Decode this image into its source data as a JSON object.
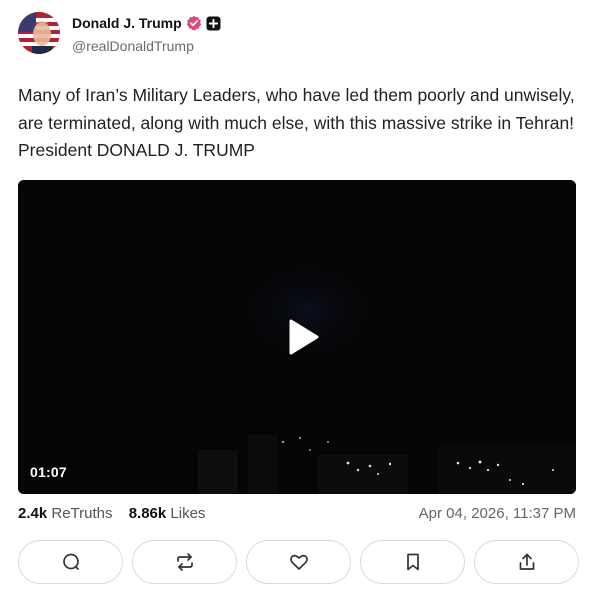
{
  "author": {
    "display_name": "Donald J. Trump",
    "handle": "@realDonaldTrump",
    "avatar_icon": "flag-portrait-avatar",
    "verified_icon": "verified-badge-icon",
    "verified_color": "#e0457b"
  },
  "post": {
    "text": "Many of Iran’s Military Leaders, who have led them poorly and unwisely, are terminated, along with much else, with this massive strike in Tehran! President DONALD J. TRUMP"
  },
  "video": {
    "duration": "01:07",
    "play_icon": "play-icon"
  },
  "stats": {
    "retruths_count": "2.4k",
    "retruths_label": "ReTruths",
    "likes_count": "8.86k",
    "likes_label": "Likes",
    "timestamp": "Apr 04, 2026, 11:37 PM"
  },
  "actions": [
    {
      "icon": "reply-icon"
    },
    {
      "icon": "retruth-icon"
    },
    {
      "icon": "heart-icon"
    },
    {
      "icon": "bookmark-icon"
    },
    {
      "icon": "share-icon"
    }
  ],
  "colors": {
    "accent_verified": "#e0457b",
    "border": "#d9d9d9",
    "muted_text": "#6b6b6b"
  }
}
